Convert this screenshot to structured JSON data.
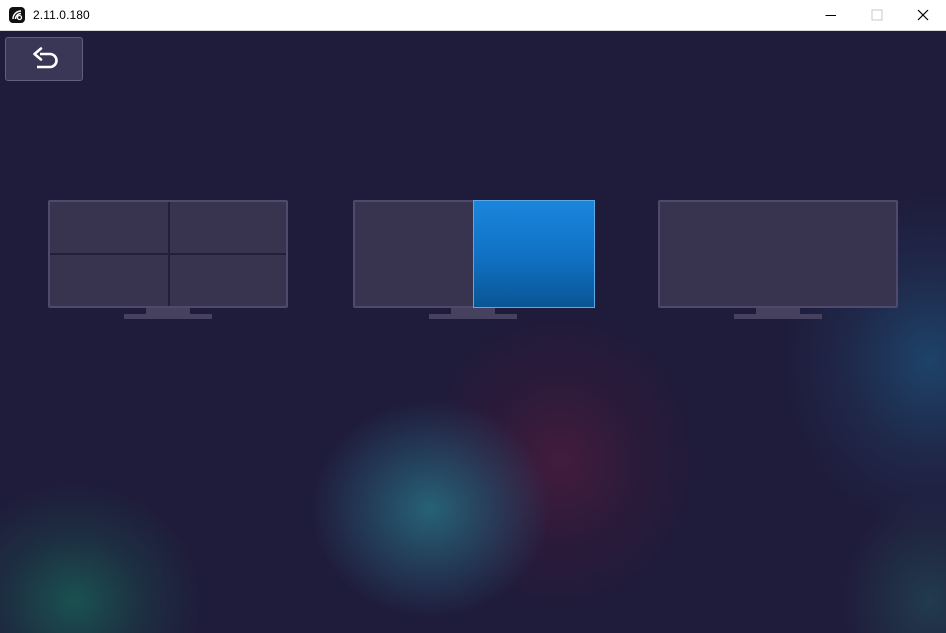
{
  "window": {
    "title": "2.11.0.180",
    "app_icon": "app-logo-icon",
    "controls": {
      "minimize_icon": "minimize-icon",
      "maximize_icon": "maximize-icon",
      "close_icon": "close-icon"
    }
  },
  "toolbar": {
    "back_icon": "back-arrow-icon"
  },
  "layouts": [
    {
      "id": "quad",
      "panes": 4,
      "selected": false
    },
    {
      "id": "split",
      "panes": 2,
      "selected": true,
      "selected_pane": "right"
    },
    {
      "id": "single",
      "panes": 1,
      "selected": false
    }
  ],
  "colors": {
    "background": "#1f1b3a",
    "monitor_fill": "#38334f",
    "monitor_border": "#4f4a6b",
    "selected_pane": "#1478cc",
    "back_button": "#3a3656"
  }
}
